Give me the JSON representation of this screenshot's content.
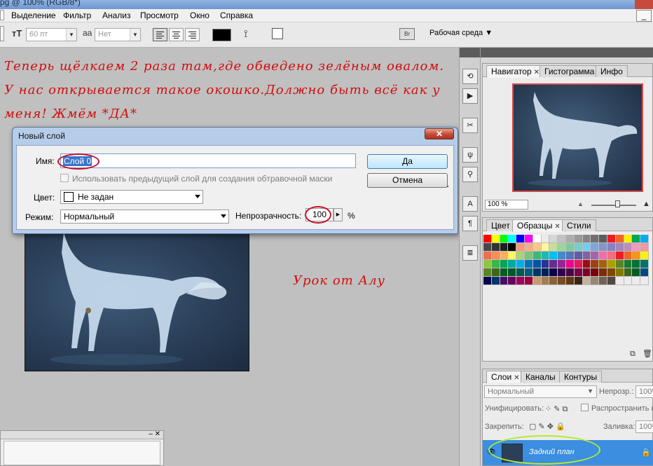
{
  "window": {
    "title": "pg @ 100% (RGB/8*)"
  },
  "menu": [
    "Выделение",
    "Фильтр",
    "Анализ",
    "Просмотр",
    "Окно",
    "Справка"
  ],
  "options_bar": {
    "font_size": "60 пт",
    "antialias_label": "aa",
    "antialias_value": "Нет",
    "workspace": "Рабочая среда"
  },
  "tutorial_text": [
    "Теперь щёлкаем 2 раза там,где обведено зелёным овалом.",
    "У нас открывается такое окошко.Должно быть всё как у",
    "меня! Жмём *ДА*"
  ],
  "signature_text": "Урок от Алу",
  "dialog": {
    "title": "Новый слой",
    "name_label": "Имя:",
    "name_value": "Слой 0",
    "clipping_label": "Использовать предыдущий слой для создания обтравочной маски",
    "color_label": "Цвет:",
    "color_value": "Не задан",
    "mode_label": "Режим:",
    "mode_value": "Нормальный",
    "opacity_label": "Непрозрачность:",
    "opacity_value": "100",
    "opacity_unit": "%",
    "ok_label": "Да",
    "cancel_label": "Отмена"
  },
  "navigator_panel": {
    "tabs": [
      "Навигатор",
      "Гистограмма",
      "Инфо"
    ],
    "zoom": "100 %"
  },
  "swatches_panel": {
    "tabs": [
      "Цвет",
      "Образцы",
      "Стили"
    ]
  },
  "layers_panel": {
    "tabs": [
      "Слои",
      "Каналы",
      "Контуры"
    ],
    "blend_mode": "Нормальный",
    "opacity_label": "Непрозр.:",
    "opacity_value": "100%",
    "unify_label": "Унифицировать:",
    "propagate_label": "Распространить к",
    "lock_label": "Закрепить:",
    "fill_label": "Заливка:",
    "fill_value": "100%",
    "layer_name": "Задний план"
  },
  "colors": {
    "annotation_red": "#d10e0e",
    "highlight_oval": "#c8102e",
    "green_oval": "#b7ea2c",
    "layer_selected": "#3b8ee0"
  }
}
